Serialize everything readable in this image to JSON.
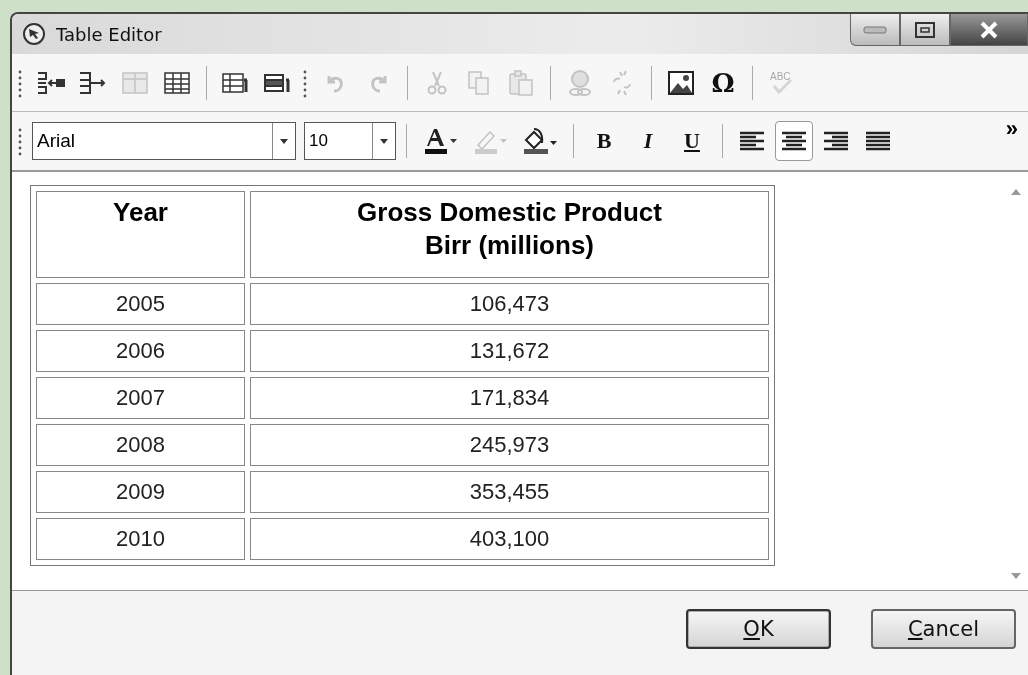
{
  "window": {
    "title": "Table Editor"
  },
  "toolbar_1": [
    {
      "kind": "insert-row-before",
      "disabled": false
    },
    {
      "kind": "insert-row-after",
      "disabled": false
    },
    {
      "kind": "merge-cells",
      "disabled": true
    },
    {
      "kind": "table",
      "disabled": false
    },
    {
      "kind": "sep"
    },
    {
      "kind": "table-properties",
      "disabled": false
    },
    {
      "kind": "cell-properties",
      "disabled": false
    },
    {
      "kind": "grip"
    },
    {
      "kind": "undo",
      "disabled": true
    },
    {
      "kind": "redo",
      "disabled": true
    },
    {
      "kind": "sep"
    },
    {
      "kind": "cut",
      "disabled": true
    },
    {
      "kind": "copy",
      "disabled": true
    },
    {
      "kind": "paste",
      "disabled": true
    },
    {
      "kind": "sep"
    },
    {
      "kind": "link",
      "disabled": true
    },
    {
      "kind": "unlink",
      "disabled": true
    },
    {
      "kind": "sep"
    },
    {
      "kind": "image",
      "disabled": false
    },
    {
      "kind": "symbol",
      "label": "Ω",
      "disabled": false
    },
    {
      "kind": "sep"
    },
    {
      "kind": "spellcheck",
      "label": "ABC",
      "disabled": true
    }
  ],
  "toolbar_2": {
    "font": "Arial",
    "size": "10",
    "format_buttons": [
      {
        "kind": "font-color",
        "disabled": false
      },
      {
        "kind": "highlight",
        "disabled": true
      },
      {
        "kind": "fill",
        "disabled": false
      }
    ],
    "style_buttons": [
      {
        "label": "B",
        "kind": "bold"
      },
      {
        "label": "I",
        "kind": "italic"
      },
      {
        "label": "U",
        "kind": "underline"
      }
    ],
    "align_buttons": [
      {
        "kind": "left",
        "selected": false
      },
      {
        "kind": "center",
        "selected": true
      },
      {
        "kind": "right",
        "selected": false
      },
      {
        "kind": "justify",
        "selected": false
      }
    ],
    "overflow": "»"
  },
  "table": {
    "columns": [
      "Year",
      "Gross Domestic Product\nBirr (millions)"
    ],
    "rows": [
      [
        "2005",
        "106,473"
      ],
      [
        "2006",
        "131,672"
      ],
      [
        "2007",
        "171,834"
      ],
      [
        "2008",
        "245,973"
      ],
      [
        "2009",
        "353,455"
      ],
      [
        "2010",
        "403,100"
      ]
    ]
  },
  "buttons": [
    {
      "key": "O",
      "rest": "K",
      "kind": "default"
    },
    {
      "key": "C",
      "rest": "ancel",
      "kind": "normal"
    }
  ]
}
